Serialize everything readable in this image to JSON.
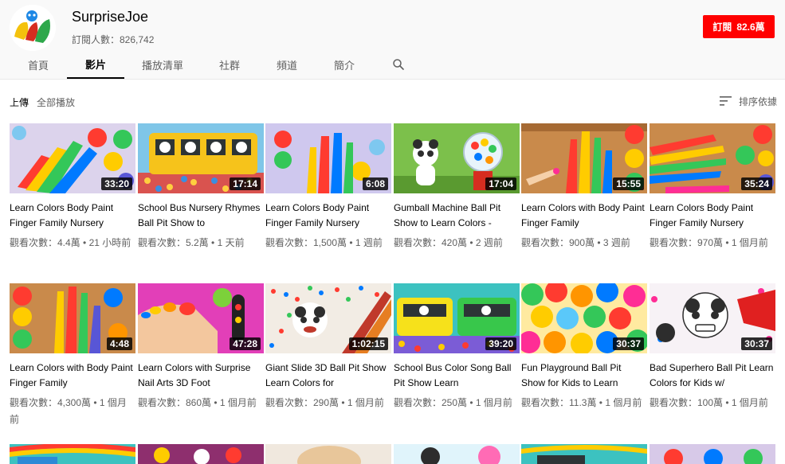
{
  "channel": {
    "name": "SurpriseJoe",
    "subscribers": "訂閱人數：826,742",
    "subscribe_label": "訂閱",
    "subscribe_count": "82.6萬"
  },
  "tabs": [
    {
      "label": "首頁"
    },
    {
      "label": "影片"
    },
    {
      "label": "播放清單"
    },
    {
      "label": "社群"
    },
    {
      "label": "頻道"
    },
    {
      "label": "簡介"
    }
  ],
  "filters": {
    "uploads": "上傳",
    "play_all": "全部播放",
    "sort": "排序依據"
  },
  "videos": [
    {
      "title": "Learn Colors Body Paint Finger Family Nursery",
      "views": "觀看次數：4.4萬",
      "age": "21 小時前",
      "duration": "33:20"
    },
    {
      "title": "School Bus Nursery Rhymes Ball Pit Show to",
      "views": "觀看次數：5.2萬",
      "age": "1 天前",
      "duration": "17:14"
    },
    {
      "title": "Learn Colors Body Paint Finger Family Nursery",
      "views": "觀看次數：1,500萬",
      "age": "1 週前",
      "duration": "6:08"
    },
    {
      "title": "Gumball Machine Ball Pit Show to Learn Colors -",
      "views": "觀看次數：420萬",
      "age": "2 週前",
      "duration": "17:04"
    },
    {
      "title": "Learn Colors with Body Paint Finger Family",
      "views": "觀看次數：900萬",
      "age": "3 週前",
      "duration": "15:55"
    },
    {
      "title": "Learn Colors Body Paint Finger Family Nursery",
      "views": "觀看次數：970萬",
      "age": "1 個月前",
      "duration": "35:24"
    },
    {
      "title": "Learn Colors with Body Paint Finger Family",
      "views": "觀看次數：4,300萬",
      "age": "1 個月前",
      "duration": "4:48"
    },
    {
      "title": "Learn Colors with Surprise Nail Arts 3D Foot",
      "views": "觀看次數：860萬",
      "age": "1 個月前",
      "duration": "47:28"
    },
    {
      "title": "Giant Slide 3D Ball Pit Show Learn Colors for",
      "views": "觀看次數：290萬",
      "age": "1 個月前",
      "duration": "1:02:15"
    },
    {
      "title": "School Bus Color Song Ball Pit Show Learn",
      "views": "觀看次數：250萬",
      "age": "1 個月前",
      "duration": "39:20"
    },
    {
      "title": "Fun Playground Ball Pit Show for Kids to Learn",
      "views": "觀看次數：11.3萬",
      "age": "1 個月前",
      "duration": "30:37"
    },
    {
      "title": "Bad Superhero Ball Pit Learn Colors for Kids w/",
      "views": "觀看次數：100萬",
      "age": "1 個月前",
      "duration": "30:37"
    }
  ],
  "colors": {
    "subscribe": "#ff0000",
    "text_primary": "#030303",
    "text_secondary": "#606060"
  }
}
